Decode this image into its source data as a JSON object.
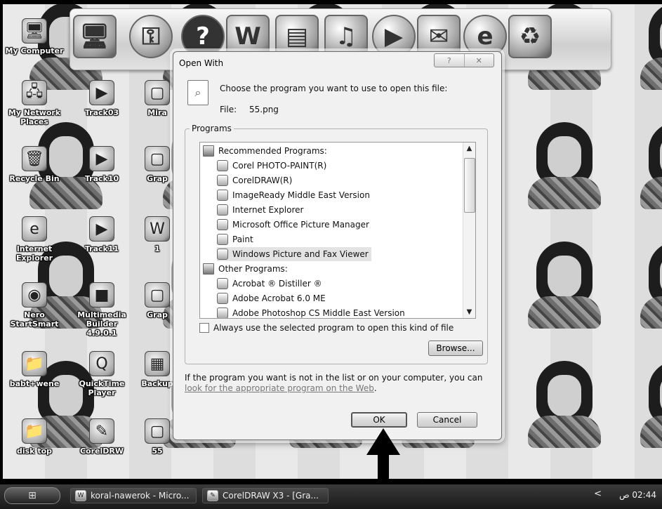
{
  "desktop": {
    "icons": [
      {
        "label": "My Computer",
        "glyph": "🖥"
      },
      {
        "label": "My Network Places",
        "glyph": "🖧"
      },
      {
        "label": "Recycle Bin",
        "glyph": "🗑"
      },
      {
        "label": "Internet Explorer",
        "glyph": "e"
      },
      {
        "label": "Nero StartSmart",
        "glyph": "◉"
      },
      {
        "label": "babt+wene",
        "glyph": "📁"
      },
      {
        "label": "disk top",
        "glyph": "📁"
      },
      {
        "label": "Track03",
        "glyph": "▶"
      },
      {
        "label": "Track10",
        "glyph": "▶"
      },
      {
        "label": "Track11",
        "glyph": "▶"
      },
      {
        "label": "Multimedia Builder 4.9.0.1",
        "glyph": "■"
      },
      {
        "label": "QuickTime Player",
        "glyph": "Q"
      },
      {
        "label": "CorelDRW",
        "glyph": "✎"
      },
      {
        "label": "Mira",
        "glyph": "▢"
      },
      {
        "label": "Grap",
        "glyph": "▢"
      },
      {
        "label": "1",
        "glyph": "W"
      },
      {
        "label": "Grap",
        "glyph": "▢"
      },
      {
        "label": "Backup",
        "glyph": "▦"
      },
      {
        "label": "55",
        "glyph": "▢"
      }
    ],
    "dock_icons": [
      "computer-icon",
      "key-icon",
      "help-icon",
      "word-document-icon",
      "folder-icon",
      "music-icon",
      "media-player-icon",
      "mail-icon",
      "internet-explorer-icon",
      "recycle-bin-icon"
    ]
  },
  "dialog": {
    "title": "Open With",
    "help_glyph": "?",
    "close_glyph": "✕",
    "prompt": "Choose the program you want to use to open this file:",
    "file_label": "File:",
    "file_name": "55.png",
    "programs_legend": "Programs",
    "recommended_header": "Recommended Programs:",
    "recommended": [
      "Corel PHOTO-PAINT(R)",
      "CorelDRAW(R)",
      "ImageReady Middle East Version",
      "Internet Explorer",
      "Microsoft Office Picture Manager",
      "Paint",
      "Windows Picture and Fax Viewer"
    ],
    "other_header": "Other Programs:",
    "other": [
      "Acrobat ® Distiller ®",
      "Adobe Acrobat 6.0 ME",
      "Adobe Photoshop CS Middle East Version"
    ],
    "selected_program": "Windows Picture and Fax Viewer",
    "always_label": "Always use the selected program to open this kind of file",
    "browse_label": "Browse...",
    "info_text": "If the program you want is not in the list or on your computer, you can ",
    "info_link": "look for the appropriate program on the Web",
    "info_end": ".",
    "ok_label": "OK",
    "cancel_label": "Cancel"
  },
  "taskbar": {
    "tasks": [
      {
        "label": "koral-nawerok - Micro...",
        "icon": "word-icon"
      },
      {
        "label": "CorelDRAW X3 - [Gra...",
        "icon": "coreldraw-icon"
      }
    ],
    "clock": "02:44 ص",
    "tray_arrow": "<"
  },
  "colors": {
    "dialog_bg": "#f1f1f1",
    "selection": "#e3e3e3",
    "taskbar": "#2a2a2a"
  }
}
